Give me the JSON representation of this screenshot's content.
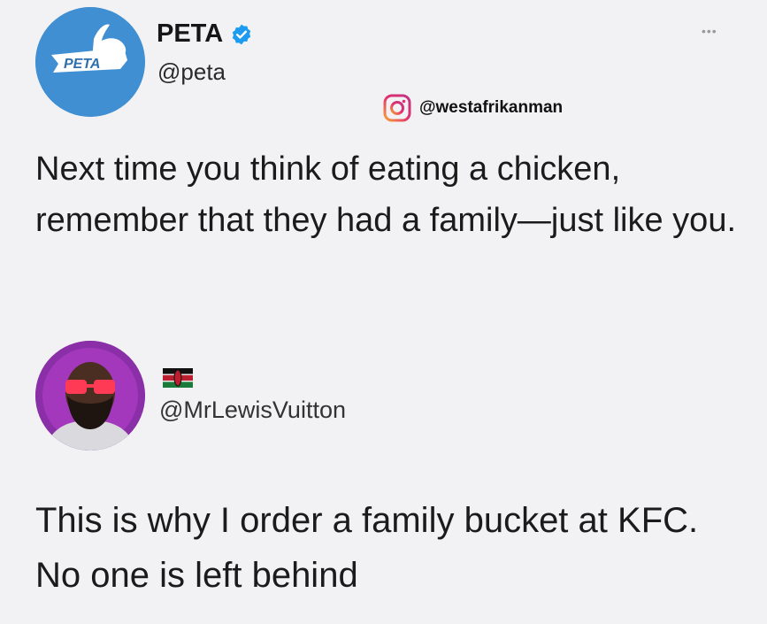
{
  "tweet_author": {
    "name": "PETA",
    "handle": "@peta",
    "logo_text": "PETA",
    "verified": true
  },
  "watermark": {
    "icon": "instagram-icon",
    "handle": "@westafrikanman"
  },
  "tweet": {
    "text": "Next time you think of eating a chicken, remember that they had a family—just like you."
  },
  "reply_author": {
    "handle": "@MrLewisVuitton",
    "flag": "kenya-flag"
  },
  "reply": {
    "text": "This is why I order a family bucket at KFC. No one is left behind"
  },
  "colors": {
    "background": "#f2f2f4",
    "peta_blue": "#3f8fd2",
    "verified_blue": "#1d9bf0"
  }
}
